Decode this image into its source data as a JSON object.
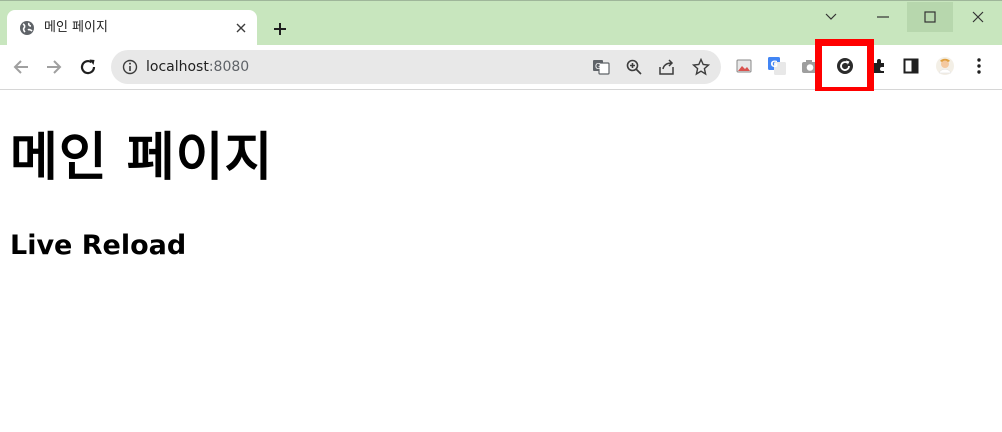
{
  "browser": {
    "tab": {
      "title": "메인 페이지",
      "favicon": "globe-icon",
      "close_icon": "close-icon"
    },
    "new_tab_icon": "plus-icon",
    "window_controls": [
      "chevron-down-icon",
      "minimize-icon",
      "maximize-icon",
      "close-icon"
    ],
    "address_bar": {
      "host": "localhost",
      "port": ":8080",
      "info_icon": "info-icon",
      "actions": [
        "translate-icon",
        "zoom-icon",
        "share-icon",
        "star-icon"
      ]
    },
    "extensions": [
      "image-extension-icon",
      "google-translate-icon",
      "camera-icon",
      "live-reload-icon",
      "puzzle-icon",
      "side-panel-icon",
      "profile-avatar-icon",
      "kebab-menu-icon"
    ],
    "highlighted_extension": "live-reload-icon",
    "colors": {
      "tabstrip": "#c8e6be",
      "omnibox": "#e8e8e8",
      "highlight": "#ff0000"
    }
  },
  "page": {
    "heading": "메인 페이지",
    "subheading": "Live Reload"
  }
}
